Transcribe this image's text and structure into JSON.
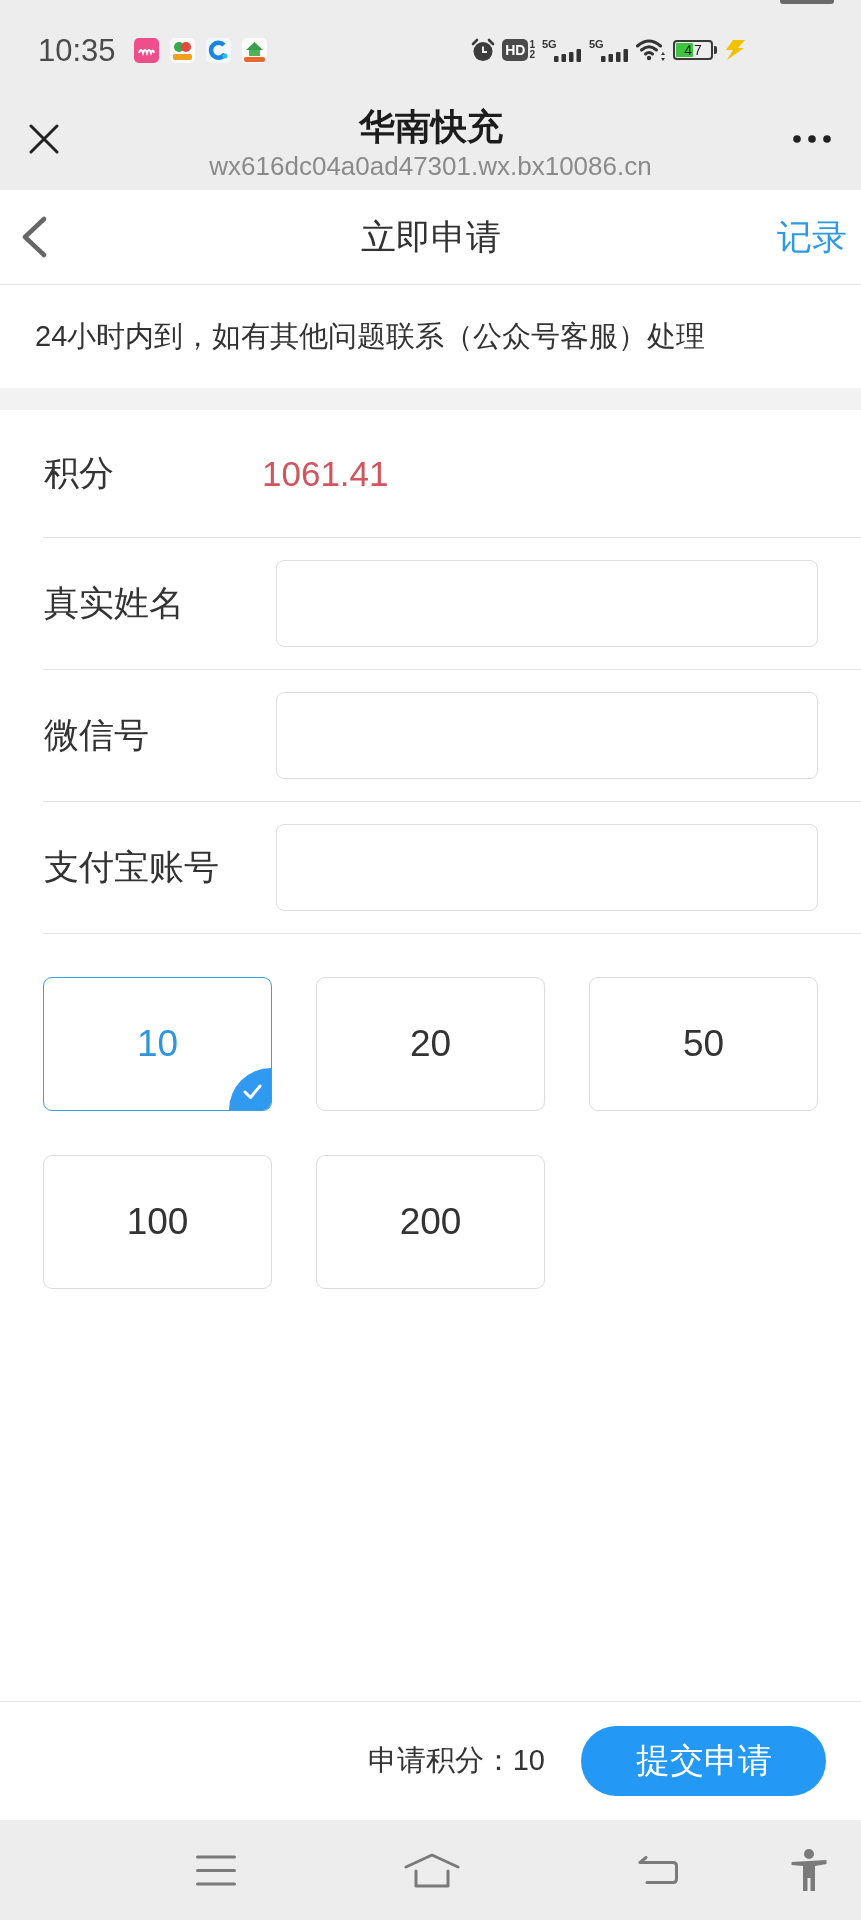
{
  "status_bar": {
    "time": "10:35",
    "hd": {
      "label": "HD",
      "sims": [
        "1",
        "2"
      ]
    },
    "networks": [
      {
        "label": "5G"
      },
      {
        "label": "5G"
      }
    ],
    "battery": "47"
  },
  "browser_bar": {
    "title": "华南快充",
    "url": "wx616dc04a0ad47301.wx.bx10086.cn"
  },
  "page_header": {
    "title": "立即申请",
    "action": "记录"
  },
  "notice": "24小时内到，如有其他问题联系（公众号客服）处理",
  "points": {
    "label": "积分",
    "value": "1061.41"
  },
  "fields": [
    {
      "label": "真实姓名"
    },
    {
      "label": "微信号"
    },
    {
      "label": "支付宝账号"
    }
  ],
  "amounts": [
    {
      "label": "10",
      "selected": true
    },
    {
      "label": "20",
      "selected": false
    },
    {
      "label": "50",
      "selected": false
    },
    {
      "label": "100",
      "selected": false
    },
    {
      "label": "200",
      "selected": false
    }
  ],
  "footer": {
    "summary": "申请积分：10",
    "submit": "提交申请"
  }
}
